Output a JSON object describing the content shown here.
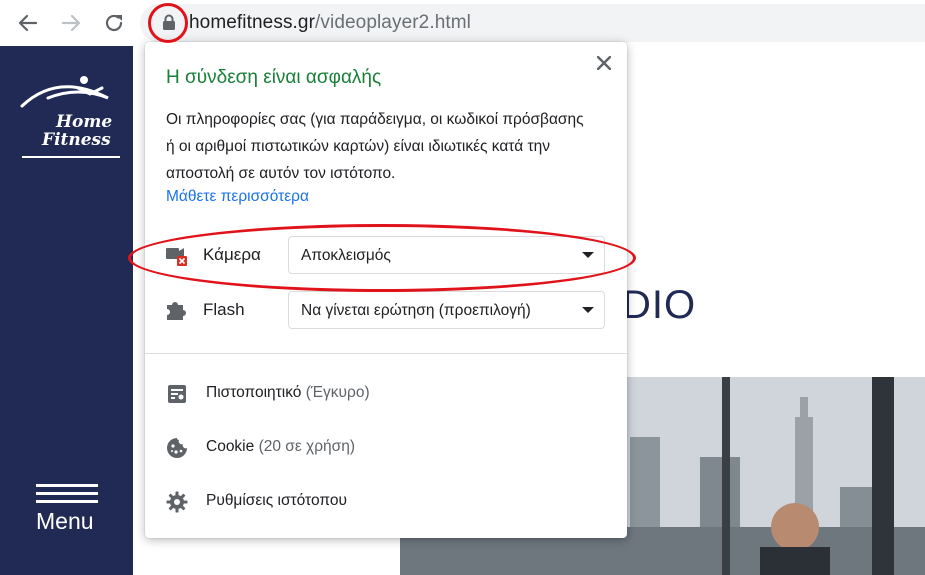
{
  "browser": {
    "url_host": "homefitness.gr",
    "url_path": "/videoplayer2.html"
  },
  "sidebar": {
    "logo_line1": "Home",
    "logo_line2": "Fitness",
    "menu_label": "Menu"
  },
  "page": {
    "heading_fragment": "DIO"
  },
  "popup": {
    "title": "Η σύνδεση είναι ασφαλής",
    "description": "Οι πληροφορίες σας (για παράδειγμα, οι κωδικοί πρόσβασης ή οι αριθμοί πιστωτικών καρτών) είναι ιδιωτικές κατά την αποστολή σε αυτόν τον ιστότοπο.",
    "learn_more": "Μάθετε περισσότερα",
    "permissions": [
      {
        "icon": "camera-blocked-icon",
        "label": "Κάμερα",
        "value": "Αποκλεισμός"
      },
      {
        "icon": "puzzle-icon",
        "label": "Flash",
        "value": "Να γίνεται ερώτηση (προεπιλογή)"
      }
    ],
    "info_items": [
      {
        "icon": "certificate-icon",
        "label": "Πιστοποιητικό",
        "sub": "(Έγκυρο)"
      },
      {
        "icon": "cookie-icon",
        "label": "Cookie",
        "sub": "(20 σε χρήση)"
      },
      {
        "icon": "gear-icon",
        "label": "Ρυθμίσεις ιστότοπου",
        "sub": ""
      }
    ]
  },
  "colors": {
    "secure_green": "#188038",
    "link_blue": "#1a73e8",
    "sidebar_navy": "#212a55",
    "annotation_red": "#e0131a"
  }
}
